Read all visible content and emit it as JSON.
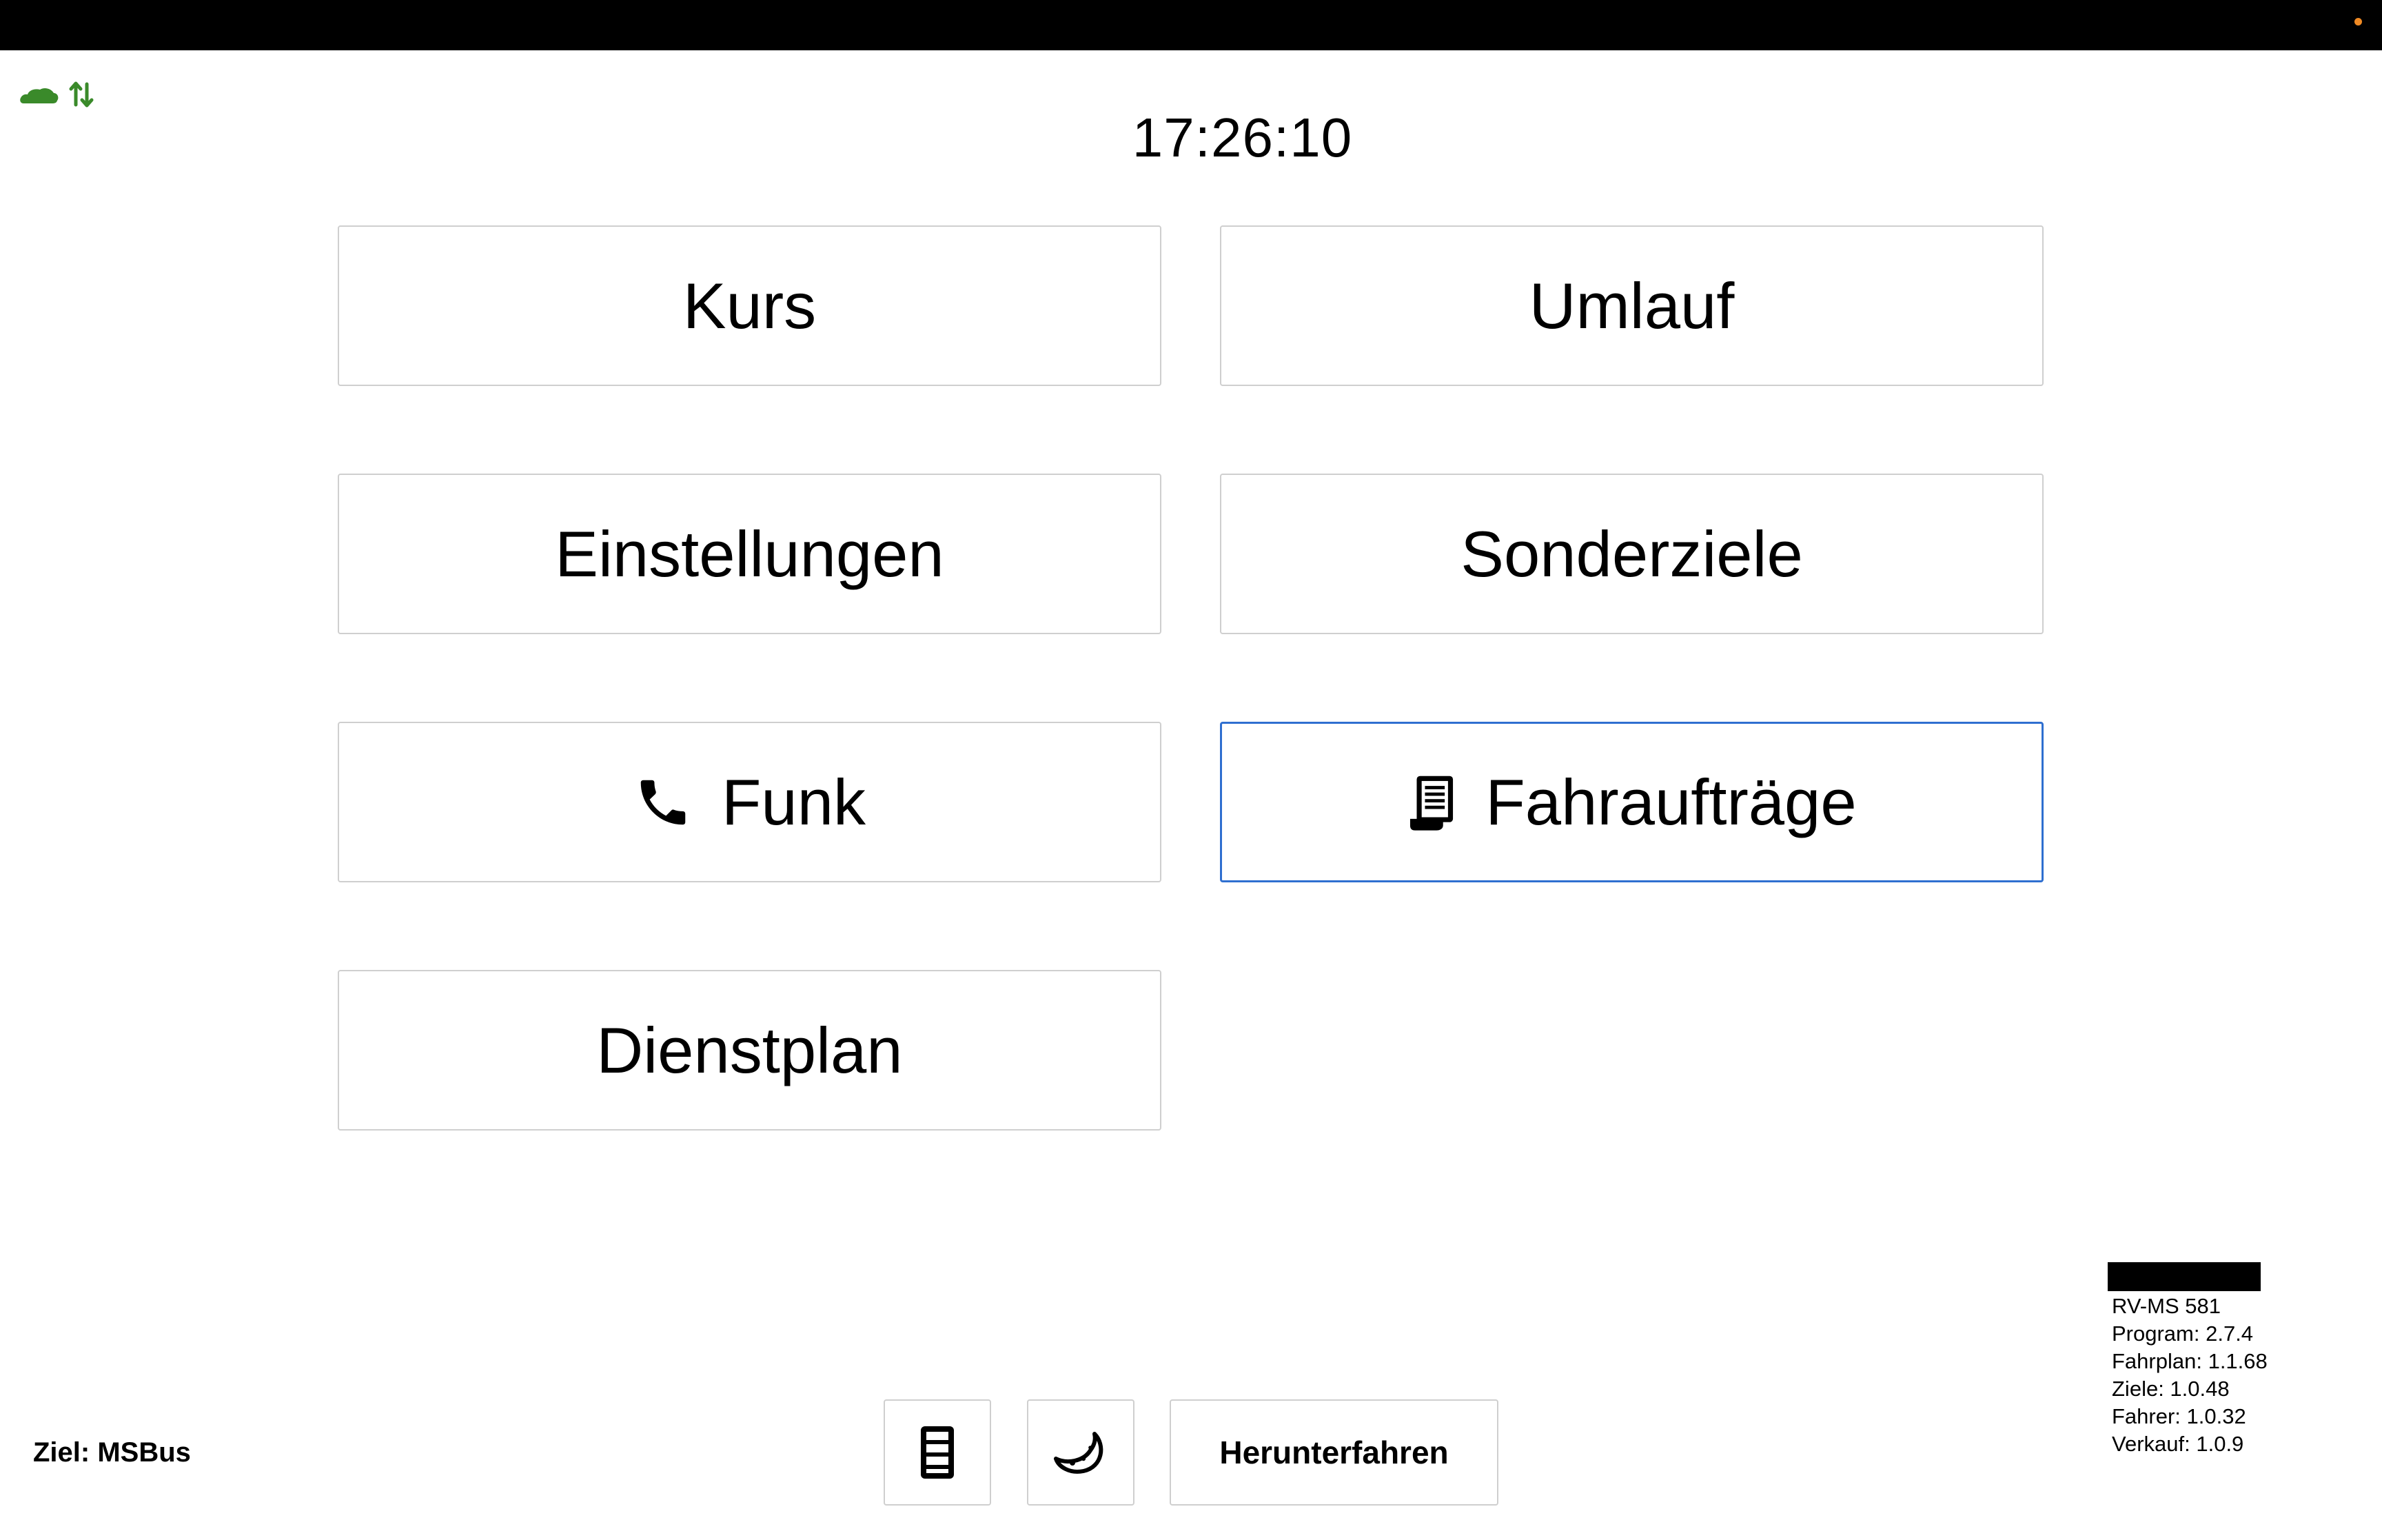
{
  "clock": "17:26:10",
  "status": {
    "cloud_icon": "cloud-icon",
    "transfer_icon": "up-down-arrows-icon",
    "accent_color": "#3a8a2a"
  },
  "menu": {
    "kurs": "Kurs",
    "umlauf": "Umlauf",
    "einstellungen": "Einstellungen",
    "sonderziele": "Sonderziele",
    "funk": "Funk",
    "fahrauftraege": "Fahraufträge",
    "dienstplan": "Dienstplan",
    "selected_color": "#2f6fd0"
  },
  "footer": {
    "ziel": "Ziel: MSBus",
    "device_icon": "device-icon",
    "night_icon": "moon-icon",
    "shutdown": "Herunterfahren"
  },
  "info": {
    "vehicle": "RV-MS 581",
    "program": "Program: 2.7.4",
    "fahrplan": "Fahrplan: 1.1.68",
    "ziele": "Ziele: 1.0.48",
    "fahrer": "Fahrer: 1.0.32",
    "verkauf": "Verkauf: 1.0.9"
  }
}
